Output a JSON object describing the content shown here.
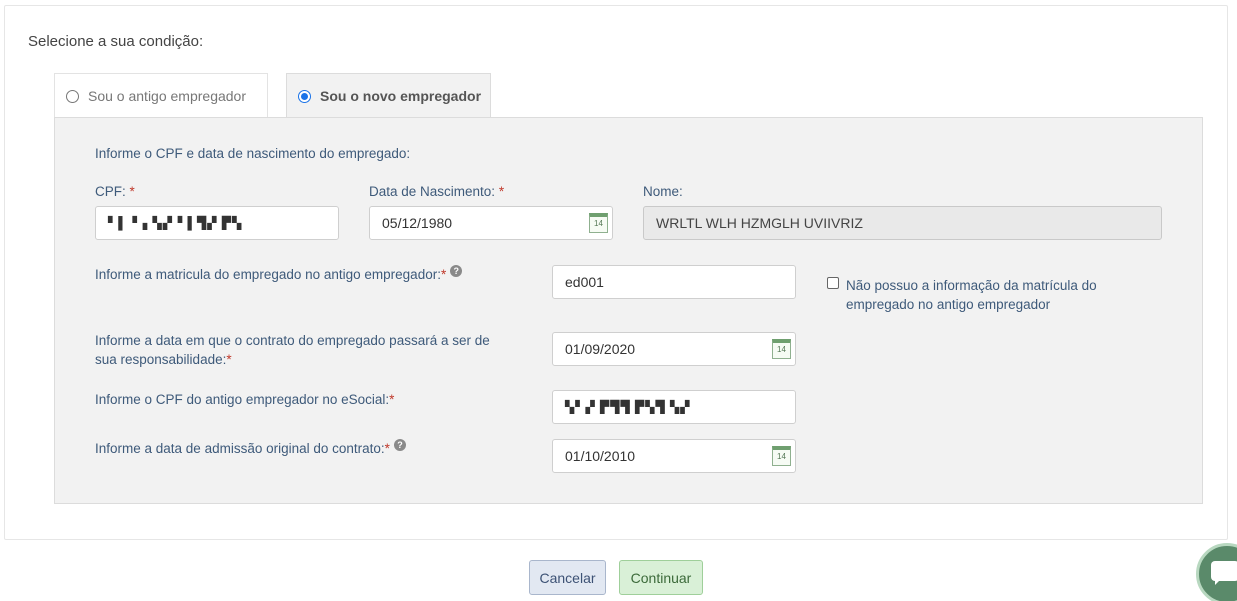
{
  "heading": "Selecione a sua condição:",
  "tabs": [
    {
      "label": "Sou o antigo empregador",
      "selected": false
    },
    {
      "label": "Sou o novo empregador",
      "selected": true
    }
  ],
  "panel": {
    "intro": "Informe o CPF e data de nascimento do empregado:",
    "cpf": {
      "label": "CPF:",
      "value": "▘▌▝▗ ▚▞▝ ▌▜▞ ▛▚"
    },
    "birth": {
      "label": "Data de Nascimento:",
      "value": "05/12/1980"
    },
    "name": {
      "label": "Nome:",
      "value": "WRLTL WLH HZMGLH UVIIVRIZ"
    },
    "matricula": {
      "label": "Informe a matricula do empregado no antigo empregador:",
      "value": "ed001"
    },
    "no_matricula": {
      "label": "Não possuo a informação da matrícula do empregado no antigo empregador",
      "checked": false
    },
    "contract_date": {
      "label": "Informe a data em que o contrato do empregado passará a ser de sua responsabilidade:",
      "value": "01/09/2020"
    },
    "old_cpf": {
      "label": "Informe o CPF do antigo empregador no eSocial:",
      "value": "▚▘▞ ▛▜▜ ▛▚▜ ▚▞"
    },
    "admission": {
      "label": "Informe a data de admissão original do contrato:",
      "value": "01/10/2010"
    },
    "required_mark": "*",
    "help_glyph": "?",
    "calendar_day": "14"
  },
  "buttons": {
    "cancel": "Cancelar",
    "continue": "Continuar"
  },
  "icons": {
    "calendar": "calendar-icon",
    "help": "help-icon",
    "chat": "chat-icon"
  }
}
